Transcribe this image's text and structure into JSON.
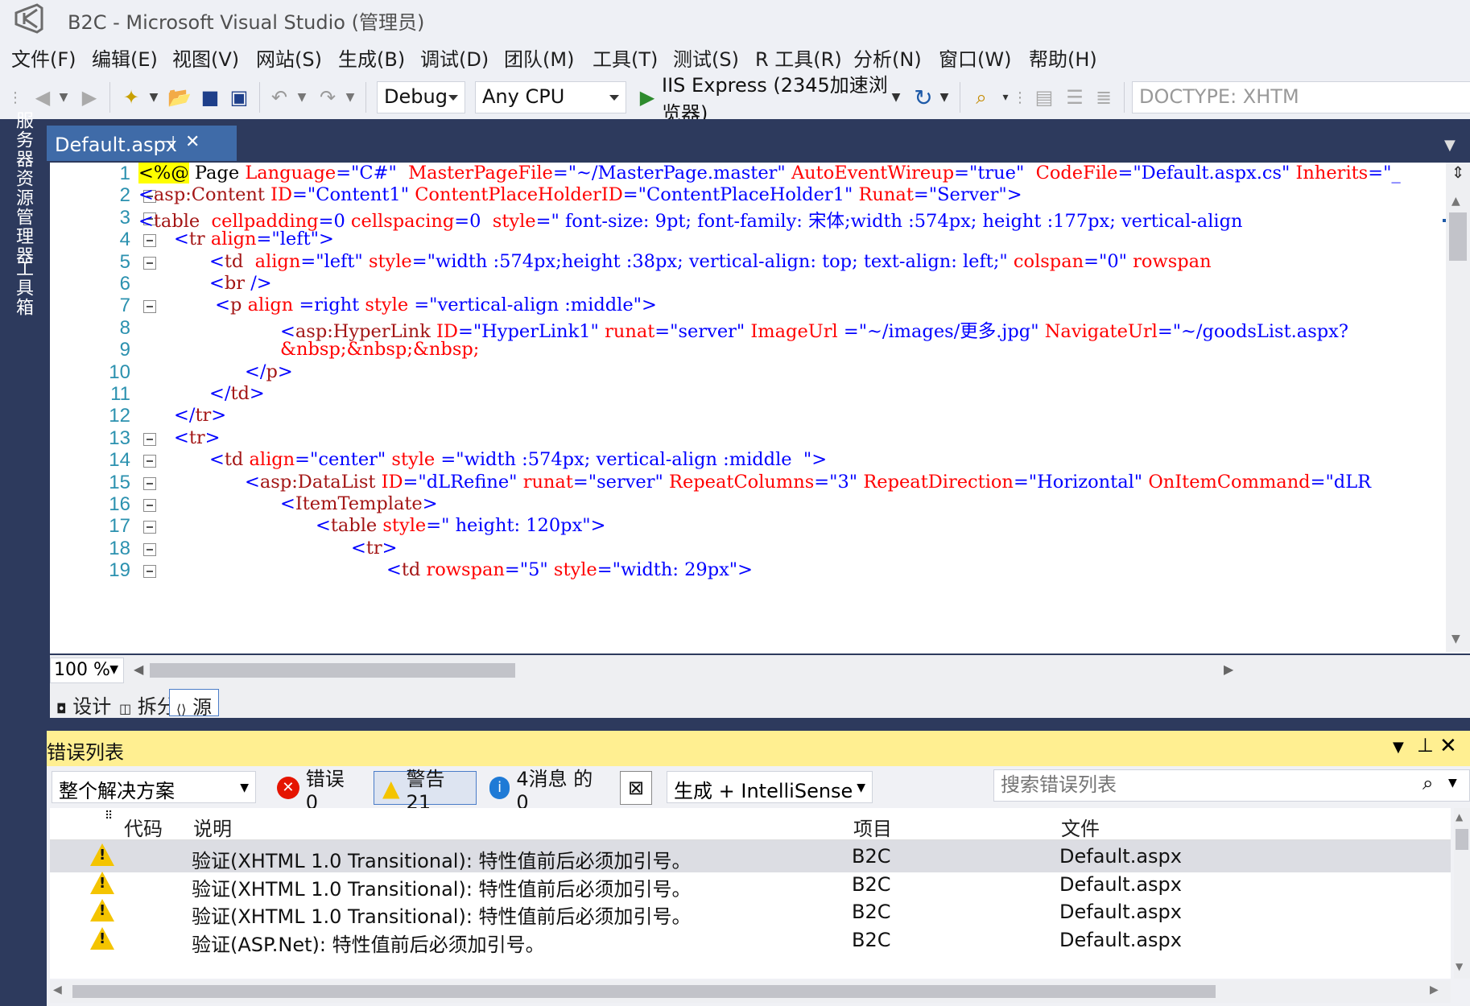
{
  "window": {
    "title": "B2C - Microsoft Visual Studio (管理员)"
  },
  "menu": [
    "文件(F)",
    "编辑(E)",
    "视图(V)",
    "网站(S)",
    "生成(B)",
    "调试(D)",
    "团队(M)",
    "工具(T)",
    "测试(S)",
    "R 工具(R)",
    "分析(N)",
    "窗口(W)",
    "帮助(H)"
  ],
  "toolbar": {
    "config": "Debug",
    "platform": "Any CPU",
    "run_target": "IIS Express (2345加速浏览器)",
    "doctype": "DOCTYPE: XHTM"
  },
  "left_rail": {
    "server_explorer": "服务器资源管理器",
    "toolbox": "工具箱"
  },
  "doc_tab": {
    "label": "Default.aspx",
    "pin": "⊣",
    "close": "✕"
  },
  "code_lines": [
    {
      "n": "1",
      "html": "<span style=\"background:#ffff00\">&lt;%@</span> <span class=\"txt\">Page</span> <span class=\"attr\">Language</span><span class=\"brk\">=</span><span class=\"val\">\"C#\"</span>  <span class=\"attr\">MasterPageFile</span><span class=\"brk\">=</span><span class=\"val\">\"~/MasterPage.master\"</span> <span class=\"attr\">AutoEventWireup</span><span class=\"brk\">=</span><span class=\"val\">\"true\"</span>  <span class=\"attr\">CodeFile</span><span class=\"brk\">=</span><span class=\"val\">\"Default.aspx.cs\"</span> <span class=\"attr\">Inherits</span><span class=\"brk\">=</span><span class=\"val\">\"_</span>",
      "indent": 0,
      "fold": false
    },
    {
      "n": "2",
      "html": "<span class=\"brk\">&lt;</span><span class=\"tag\">asp:Content</span> <span class=\"attr\">ID</span><span class=\"brk\">=</span><span class=\"val\">\"Content1\"</span> <span class=\"attr\">ContentPlaceHolderID</span><span class=\"brk\">=</span><span class=\"val\">\"ContentPlaceHolder1\"</span> <span class=\"attr\">Runat</span><span class=\"brk\">=</span><span class=\"val\">\"Server\"</span><span class=\"brk\">&gt;</span>",
      "indent": 0,
      "fold": true
    },
    {
      "n": "3",
      "html": "<span class=\"brk\">&lt;</span><span class=\"tag\">table</span>  <span class=\"attr\">cellpadding</span><span class=\"brk\">=</span><span class=\"val\">0</span> <span class=\"attr\">cellspacing</span><span class=\"brk\">=</span><span class=\"val\">0</span>  <span class=\"attr\">style</span><span class=\"brk\">=</span><span class=\"val\">\" font-size: 9pt; font-family: 宋体;width :574px; height :177px; vertical-align</span>",
      "indent": 0,
      "fold": true
    },
    {
      "n": "4",
      "html": "<span class=\"brk\">&lt;</span><span class=\"tag\">tr</span> <span class=\"attr\">align</span><span class=\"brk\">=</span><span class=\"val\">\"left\"</span><span class=\"brk\">&gt;</span>",
      "indent": 1,
      "fold": true
    },
    {
      "n": "5",
      "html": "<span class=\"brk\">&lt;</span><span class=\"tag\">td</span>  <span class=\"attr\">align</span><span class=\"brk\">=</span><span class=\"val\">\"left\"</span> <span class=\"attr\">style</span><span class=\"brk\">=</span><span class=\"val\">\"width :574px;height :38px; vertical-align: top; text-align: left;\"</span> <span class=\"attr\">colspan</span><span class=\"brk\">=</span><span class=\"val\">\"0\"</span> <span class=\"attr\">rowspan</span>",
      "indent": 2,
      "fold": true
    },
    {
      "n": "6",
      "html": "<span class=\"brk\">&lt;</span><span class=\"tag\">br</span> <span class=\"brk\">/&gt;</span>",
      "indent": 2,
      "fold": false
    },
    {
      "n": "7",
      "html": " <span class=\"brk\">&lt;</span><span class=\"tag\">p</span> <span class=\"attr\">align</span> <span class=\"brk\">=</span><span class=\"val\">right</span> <span class=\"attr\">style</span> <span class=\"brk\">=</span><span class=\"val\">\"vertical-align :middle\"</span><span class=\"brk\">&gt;</span>",
      "indent": 2,
      "fold": true
    },
    {
      "n": "8",
      "html": "<span class=\"brk\">&lt;</span><span class=\"tag\">asp:HyperLink</span> <span class=\"attr\">ID</span><span class=\"brk\">=</span><span class=\"val\">\"HyperLink1\"</span> <span class=\"attr\">runat</span><span class=\"brk\">=</span><span class=\"val\">\"server\"</span> <span class=\"attr\">ImageUrl</span> <span class=\"brk\">=</span><span class=\"val\">\"~/images/更多.jpg\"</span> <span class=\"attr\">NavigateUrl</span><span class=\"brk\">=</span><span class=\"val\">\"~/goodsList.aspx?</span>",
      "indent": 4,
      "fold": false
    },
    {
      "n": "9",
      "html": "<span class=\"attr\">&amp;nbsp;&amp;nbsp;&amp;nbsp;</span>",
      "indent": 4,
      "fold": false
    },
    {
      "n": "10",
      "html": "<span class=\"brk\">&lt;/</span><span class=\"tag\">p</span><span class=\"brk\">&gt;</span>",
      "indent": 3,
      "fold": false
    },
    {
      "n": "11",
      "html": "<span class=\"brk\">&lt;/</span><span class=\"tag\">td</span><span class=\"brk\">&gt;</span>",
      "indent": 2,
      "fold": false
    },
    {
      "n": "12",
      "html": "<span class=\"brk\">&lt;/</span><span class=\"tag\">tr</span><span class=\"brk\">&gt;</span>",
      "indent": 1,
      "fold": false
    },
    {
      "n": "13",
      "html": "<span class=\"brk\">&lt;</span><span class=\"tag\">tr</span><span class=\"brk\">&gt;</span>",
      "indent": 1,
      "fold": true
    },
    {
      "n": "14",
      "html": "<span class=\"brk\">&lt;</span><span class=\"tag\">td</span> <span class=\"attr\">align</span><span class=\"brk\">=</span><span class=\"val\">\"center\"</span> <span class=\"attr\">style</span> <span class=\"brk\">=</span><span class=\"val\">\"width :574px; vertical-align :middle  \"</span><span class=\"brk\">&gt;</span>",
      "indent": 2,
      "fold": true
    },
    {
      "n": "15",
      "html": "<span class=\"brk\">&lt;</span><span class=\"tag\">asp:DataList</span> <span class=\"attr\">ID</span><span class=\"brk\">=</span><span class=\"val\">\"dLRefine\"</span> <span class=\"attr\">runat</span><span class=\"brk\">=</span><span class=\"val\">\"server\"</span> <span class=\"attr\">RepeatColumns</span><span class=\"brk\">=</span><span class=\"val\">\"3\"</span> <span class=\"attr\">RepeatDirection</span><span class=\"brk\">=</span><span class=\"val\">\"Horizontal\"</span> <span class=\"attr\">OnItemCommand</span><span class=\"brk\">=</span><span class=\"val\">\"dLR</span>",
      "indent": 3,
      "fold": true
    },
    {
      "n": "16",
      "html": "<span class=\"brk\">&lt;</span><span class=\"tag\">ItemTemplate</span><span class=\"brk\">&gt;</span>",
      "indent": 4,
      "fold": true
    },
    {
      "n": "17",
      "html": "<span class=\"brk\">&lt;</span><span class=\"tag\">table</span> <span class=\"attr\">style</span><span class=\"brk\">=</span><span class=\"val\">\" height: 120px\"</span><span class=\"brk\">&gt;</span>",
      "indent": 5,
      "fold": true
    },
    {
      "n": "18",
      "html": "<span class=\"brk\">&lt;</span><span class=\"tag\">tr</span><span class=\"brk\">&gt;</span>",
      "indent": 6,
      "fold": true
    },
    {
      "n": "19",
      "html": "<span class=\"brk\">&lt;</span><span class=\"tag\">td</span> <span class=\"attr\">rowspan</span><span class=\"brk\">=</span><span class=\"val\">\"5\"</span> <span class=\"attr\">style</span><span class=\"brk\">=</span><span class=\"val\">\"width: 29px\"</span><span class=\"brk\">&gt;</span>",
      "indent": 7,
      "fold": true
    }
  ],
  "zoom": "100 %",
  "view_tabs": {
    "design": "设计",
    "split": "拆分",
    "source": "源"
  },
  "error_panel": {
    "title": "错误列表",
    "scope": "整个解决方案",
    "errors": "错误 0",
    "warnings": "警告 21",
    "messages": "4消息 的 0",
    "build_filter": "生成 + IntelliSense",
    "search_placeholder": "搜索错误列表",
    "columns": {
      "code": "代码",
      "desc": "说明",
      "project": "项目",
      "file": "文件"
    },
    "rows": [
      {
        "desc": "验证(XHTML 1.0 Transitional): 特性值前后必须加引号。",
        "project": "B2C",
        "file": "Default.aspx"
      },
      {
        "desc": "验证(XHTML 1.0 Transitional): 特性值前后必须加引号。",
        "project": "B2C",
        "file": "Default.aspx"
      },
      {
        "desc": "验证(XHTML 1.0 Transitional): 特性值前后必须加引号。",
        "project": "B2C",
        "file": "Default.aspx"
      },
      {
        "desc": "验证(ASP.Net): 特性值前后必须加引号。",
        "project": "B2C",
        "file": "Default.aspx"
      }
    ]
  }
}
